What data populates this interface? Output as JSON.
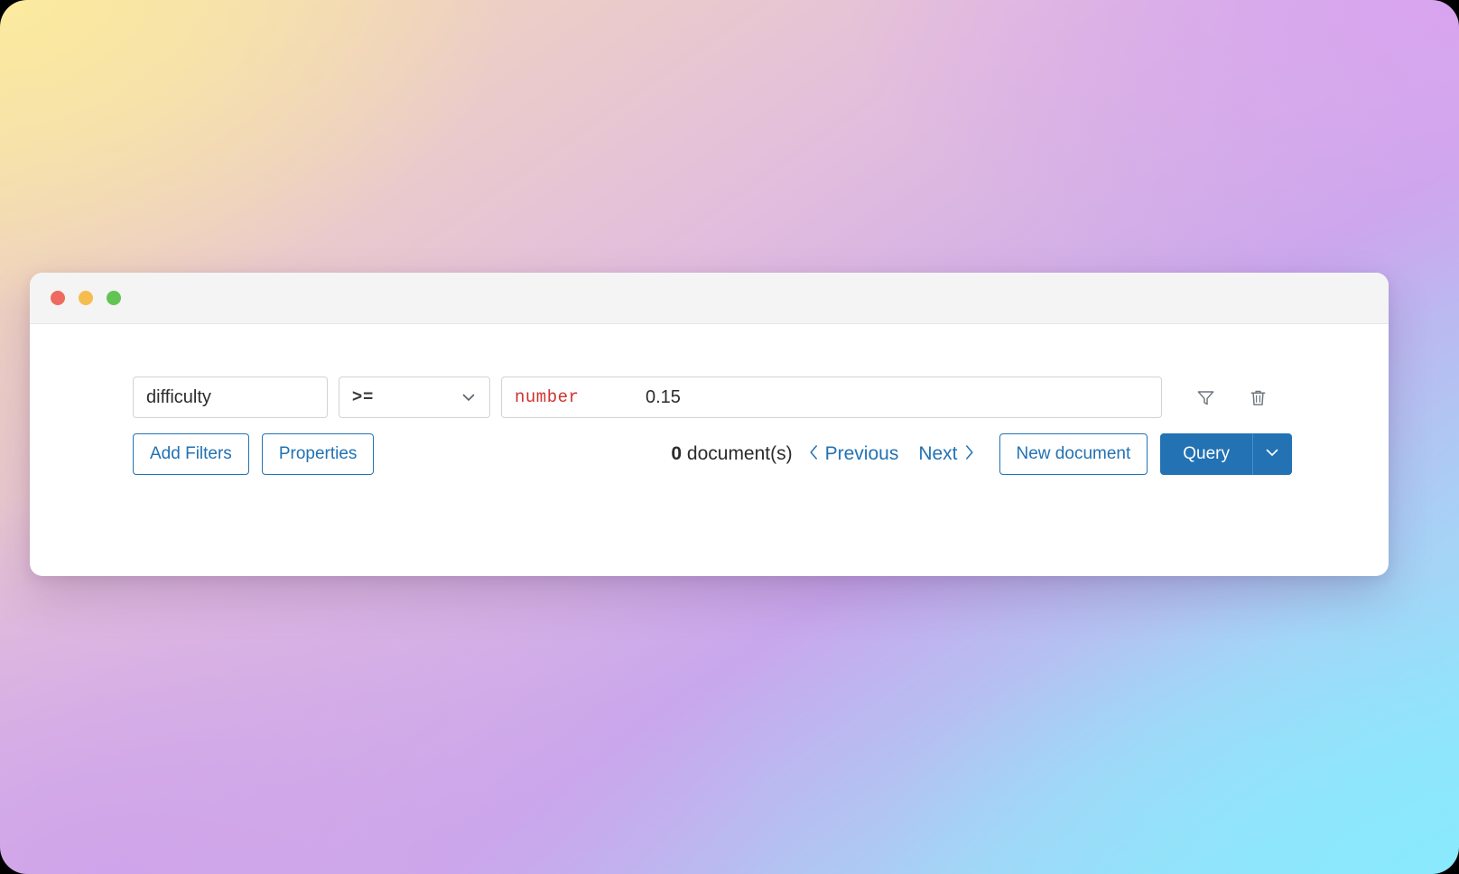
{
  "window": {
    "traffic_lights": [
      {
        "name": "close",
        "color": "#ef6a5e"
      },
      {
        "name": "minimize",
        "color": "#f5bd4f"
      },
      {
        "name": "maximize",
        "color": "#61c454"
      }
    ]
  },
  "filter_row": {
    "field_name": {
      "value": "difficulty",
      "placeholder": "Field"
    },
    "operator": {
      "value": ">=",
      "icon": "chevron-down-icon"
    },
    "value_field": {
      "type_label": "number",
      "value": "0.15"
    },
    "icons": [
      {
        "name": "filter-icon",
        "title": "Filter"
      },
      {
        "name": "trash-icon",
        "title": "Delete"
      }
    ]
  },
  "actions": {
    "add_filters_label": "Add Filters",
    "properties_label": "Properties",
    "new_document_label": "New document",
    "query_label": "Query",
    "query_caret_icon": "chevron-down-icon"
  },
  "pager": {
    "count": "0",
    "count_suffix": "document(s)",
    "previous_label": "Previous",
    "next_label": "Next",
    "previous_icon": "chevron-left-icon",
    "next_icon": "chevron-right-icon"
  },
  "colors": {
    "accent": "#2272b4",
    "type_tag": "#cf342f",
    "border": "#ced4da",
    "titlebar": "#f4f4f4"
  }
}
